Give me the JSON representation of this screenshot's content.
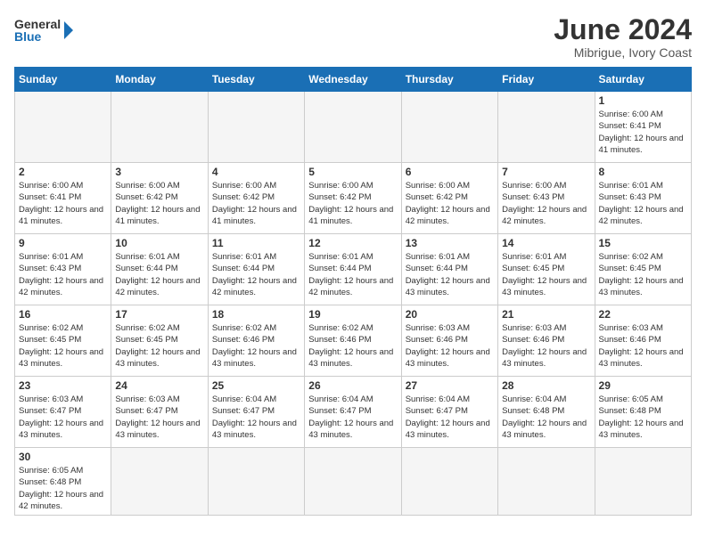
{
  "header": {
    "logo_general": "General",
    "logo_blue": "Blue",
    "title": "June 2024",
    "subtitle": "Mibrigue, Ivory Coast"
  },
  "days_of_week": [
    "Sunday",
    "Monday",
    "Tuesday",
    "Wednesday",
    "Thursday",
    "Friday",
    "Saturday"
  ],
  "weeks": [
    [
      {
        "day": "",
        "empty": true
      },
      {
        "day": "",
        "empty": true
      },
      {
        "day": "",
        "empty": true
      },
      {
        "day": "",
        "empty": true
      },
      {
        "day": "",
        "empty": true
      },
      {
        "day": "",
        "empty": true
      },
      {
        "day": "1",
        "sunrise": "6:00 AM",
        "sunset": "6:41 PM",
        "daylight": "12 hours and 41 minutes."
      }
    ],
    [
      {
        "day": "2",
        "sunrise": "6:00 AM",
        "sunset": "6:41 PM",
        "daylight": "12 hours and 41 minutes."
      },
      {
        "day": "3",
        "sunrise": "6:00 AM",
        "sunset": "6:42 PM",
        "daylight": "12 hours and 41 minutes."
      },
      {
        "day": "4",
        "sunrise": "6:00 AM",
        "sunset": "6:42 PM",
        "daylight": "12 hours and 41 minutes."
      },
      {
        "day": "5",
        "sunrise": "6:00 AM",
        "sunset": "6:42 PM",
        "daylight": "12 hours and 41 minutes."
      },
      {
        "day": "6",
        "sunrise": "6:00 AM",
        "sunset": "6:42 PM",
        "daylight": "12 hours and 42 minutes."
      },
      {
        "day": "7",
        "sunrise": "6:00 AM",
        "sunset": "6:43 PM",
        "daylight": "12 hours and 42 minutes."
      },
      {
        "day": "8",
        "sunrise": "6:01 AM",
        "sunset": "6:43 PM",
        "daylight": "12 hours and 42 minutes."
      }
    ],
    [
      {
        "day": "9",
        "sunrise": "6:01 AM",
        "sunset": "6:43 PM",
        "daylight": "12 hours and 42 minutes."
      },
      {
        "day": "10",
        "sunrise": "6:01 AM",
        "sunset": "6:44 PM",
        "daylight": "12 hours and 42 minutes."
      },
      {
        "day": "11",
        "sunrise": "6:01 AM",
        "sunset": "6:44 PM",
        "daylight": "12 hours and 42 minutes."
      },
      {
        "day": "12",
        "sunrise": "6:01 AM",
        "sunset": "6:44 PM",
        "daylight": "12 hours and 42 minutes."
      },
      {
        "day": "13",
        "sunrise": "6:01 AM",
        "sunset": "6:44 PM",
        "daylight": "12 hours and 43 minutes."
      },
      {
        "day": "14",
        "sunrise": "6:01 AM",
        "sunset": "6:45 PM",
        "daylight": "12 hours and 43 minutes."
      },
      {
        "day": "15",
        "sunrise": "6:02 AM",
        "sunset": "6:45 PM",
        "daylight": "12 hours and 43 minutes."
      }
    ],
    [
      {
        "day": "16",
        "sunrise": "6:02 AM",
        "sunset": "6:45 PM",
        "daylight": "12 hours and 43 minutes."
      },
      {
        "day": "17",
        "sunrise": "6:02 AM",
        "sunset": "6:45 PM",
        "daylight": "12 hours and 43 minutes."
      },
      {
        "day": "18",
        "sunrise": "6:02 AM",
        "sunset": "6:46 PM",
        "daylight": "12 hours and 43 minutes."
      },
      {
        "day": "19",
        "sunrise": "6:02 AM",
        "sunset": "6:46 PM",
        "daylight": "12 hours and 43 minutes."
      },
      {
        "day": "20",
        "sunrise": "6:03 AM",
        "sunset": "6:46 PM",
        "daylight": "12 hours and 43 minutes."
      },
      {
        "day": "21",
        "sunrise": "6:03 AM",
        "sunset": "6:46 PM",
        "daylight": "12 hours and 43 minutes."
      },
      {
        "day": "22",
        "sunrise": "6:03 AM",
        "sunset": "6:46 PM",
        "daylight": "12 hours and 43 minutes."
      }
    ],
    [
      {
        "day": "23",
        "sunrise": "6:03 AM",
        "sunset": "6:47 PM",
        "daylight": "12 hours and 43 minutes."
      },
      {
        "day": "24",
        "sunrise": "6:03 AM",
        "sunset": "6:47 PM",
        "daylight": "12 hours and 43 minutes."
      },
      {
        "day": "25",
        "sunrise": "6:04 AM",
        "sunset": "6:47 PM",
        "daylight": "12 hours and 43 minutes."
      },
      {
        "day": "26",
        "sunrise": "6:04 AM",
        "sunset": "6:47 PM",
        "daylight": "12 hours and 43 minutes."
      },
      {
        "day": "27",
        "sunrise": "6:04 AM",
        "sunset": "6:47 PM",
        "daylight": "12 hours and 43 minutes."
      },
      {
        "day": "28",
        "sunrise": "6:04 AM",
        "sunset": "6:48 PM",
        "daylight": "12 hours and 43 minutes."
      },
      {
        "day": "29",
        "sunrise": "6:05 AM",
        "sunset": "6:48 PM",
        "daylight": "12 hours and 43 minutes."
      }
    ],
    [
      {
        "day": "30",
        "sunrise": "6:05 AM",
        "sunset": "6:48 PM",
        "daylight": "12 hours and 42 minutes."
      },
      {
        "day": "",
        "empty": true
      },
      {
        "day": "",
        "empty": true
      },
      {
        "day": "",
        "empty": true
      },
      {
        "day": "",
        "empty": true
      },
      {
        "day": "",
        "empty": true
      },
      {
        "day": "",
        "empty": true
      }
    ]
  ]
}
